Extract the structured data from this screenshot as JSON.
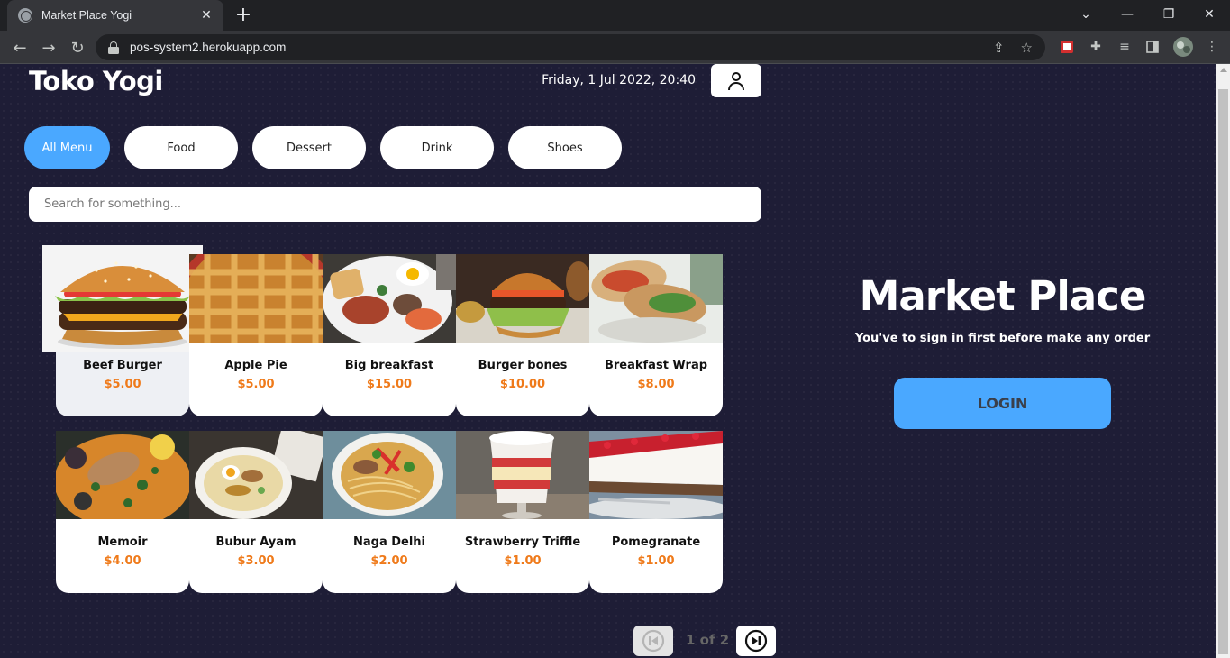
{
  "browser": {
    "tab_title": "Market Place Yogi",
    "url": "pos-system2.herokuapp.com"
  },
  "header": {
    "brand": "Toko Yogi",
    "datetime": "Friday, 1 Jul 2022, 20:40"
  },
  "categories": [
    "All Menu",
    "Food",
    "Dessert",
    "Drink",
    "Shoes"
  ],
  "active_category": "All Menu",
  "search": {
    "placeholder": "Search for something..."
  },
  "products": [
    {
      "name": "Beef Burger",
      "price": "$5.00",
      "image": "beef-burger-image"
    },
    {
      "name": "Apple Pie",
      "price": "$5.00",
      "image": "apple-pie-image"
    },
    {
      "name": "Big breakfast",
      "price": "$15.00",
      "image": "big-breakfast-image"
    },
    {
      "name": "Burger bones",
      "price": "$10.00",
      "image": "burger-bones-image"
    },
    {
      "name": "Breakfast Wrap",
      "price": "$8.00",
      "image": "breakfast-wrap-image"
    },
    {
      "name": "Memoir",
      "price": "$4.00",
      "image": "memoir-image"
    },
    {
      "name": "Bubur Ayam",
      "price": "$3.00",
      "image": "bubur-ayam-image"
    },
    {
      "name": "Naga Delhi",
      "price": "$2.00",
      "image": "naga-delhi-image"
    },
    {
      "name": "Strawberry Triffle",
      "price": "$1.00",
      "image": "strawberry-triffle-image"
    },
    {
      "name": "Pomegranate",
      "price": "$1.00",
      "image": "pomegranate-image"
    }
  ],
  "pagination": {
    "label": "1 of 2"
  },
  "side_panel": {
    "title": "Market Place",
    "subtitle": "You've to sign in first before make any order",
    "login_label": "LOGIN"
  },
  "colors": {
    "accent": "#4aa8ff",
    "price": "#ef7a1a",
    "background": "#1e1d36"
  }
}
